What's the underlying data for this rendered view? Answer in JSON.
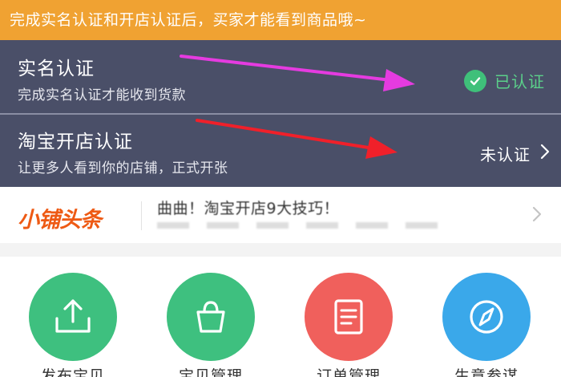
{
  "notice": {
    "text": "完成实名认证和开店认证后，买家才能看到商品哦~"
  },
  "verification": {
    "real_name": {
      "title": "实名认证",
      "subtitle": "完成实名认证才能收到货款",
      "status": "已认证",
      "status_color": "#5bd08a",
      "status_icon": "check-circle-icon"
    },
    "shop": {
      "title": "淘宝开店认证",
      "subtitle": "让更多人看到你的店铺，正式开张",
      "status": "未认证",
      "status_icon": "chevron-right-icon"
    }
  },
  "headline": {
    "logo": "小铺头条",
    "text": "曲曲！淘宝开店9大技巧！",
    "icon": "chevron-right-icon"
  },
  "grid": [
    {
      "label": "发布宝贝",
      "color": "#3ec07f",
      "icon": "upload-icon"
    },
    {
      "label": "宝贝管理",
      "color": "#3ec07f",
      "icon": "shopping-bag-icon"
    },
    {
      "label": "订单管理",
      "color": "#f0605c",
      "icon": "order-list-icon"
    },
    {
      "label": "生意参谋",
      "color": "#3aa8ea",
      "icon": "compass-icon"
    }
  ],
  "colors": {
    "banner": "#f0a232",
    "panel": "#4a4f68",
    "logo": "#ee5a14",
    "arrow_magenta": "#e53be0",
    "arrow_red": "#f0202a"
  }
}
